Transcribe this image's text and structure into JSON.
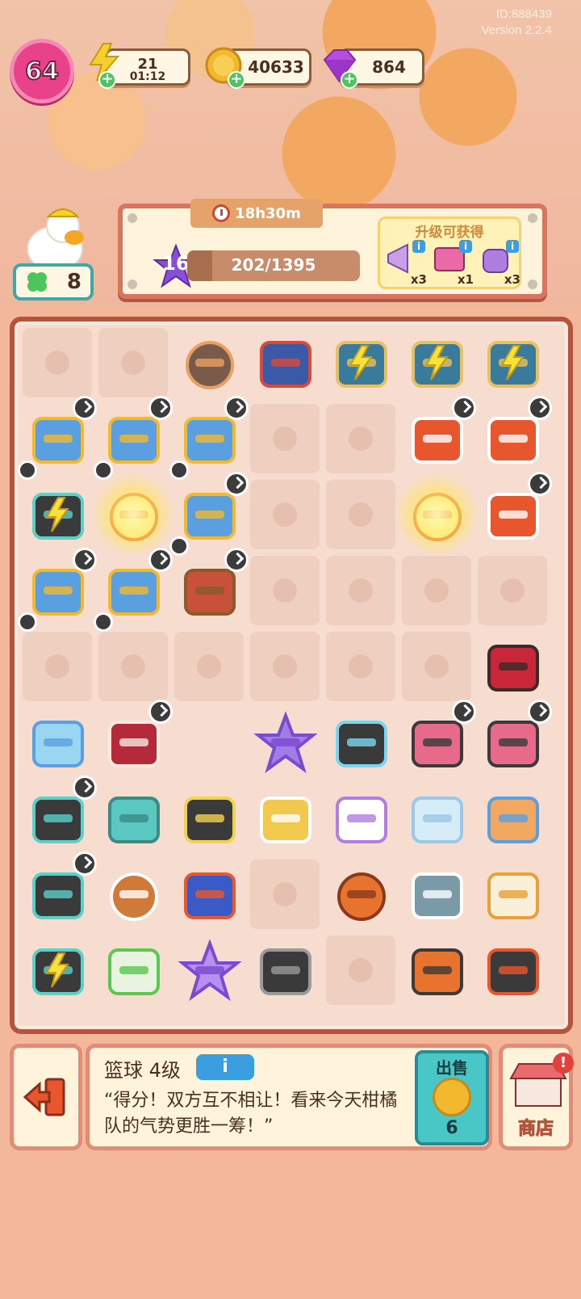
{
  "header": {
    "id_text": "ID:888439",
    "version_text": "Version 2.2.4"
  },
  "player": {
    "level": "64",
    "clover_count": "8"
  },
  "resources": {
    "energy": "21",
    "energy_timer": "01:12",
    "coins": "40633",
    "gems": "864"
  },
  "task": {
    "timer": "18h30m",
    "level": "16",
    "progress_text": "202/1395",
    "progress_fraction": 0.145,
    "reward_title": "升级可获得",
    "rewards": [
      {
        "icon": "megaphone-icon",
        "count": "x3"
      },
      {
        "icon": "go-ticket-icon",
        "count": "x1"
      },
      {
        "icon": "bag-icon",
        "count": "x3"
      }
    ]
  },
  "board": {
    "rows": 9,
    "cols": 7,
    "items": [
      [
        "empty",
        "empty",
        "lantern",
        "temple",
        "building-powered",
        "building-powered",
        "building-powered"
      ],
      [
        "suitcase-timer",
        "suitcase-timer",
        "suitcase-timer",
        "empty",
        "empty",
        "sneakers-timer",
        "sneakers-timer"
      ],
      [
        "backpack-powered",
        "orb-glow",
        "suitcase-timer",
        "empty",
        "empty",
        "orb-glow",
        "sneakers-timer"
      ],
      [
        "suitcase-timer",
        "suitcase-timer",
        "bed-timer",
        "empty",
        "empty",
        "empty",
        "empty"
      ],
      [
        "empty",
        "empty",
        "empty",
        "empty",
        "empty",
        "empty",
        "armchair"
      ],
      [
        "ice-house",
        "book-timer",
        "blank",
        "star",
        "pencil-case",
        "clock-monster-timer",
        "clock-monster-timer"
      ],
      [
        "backpack-timer",
        "drawstring-bag",
        "card",
        "van",
        "tshirt",
        "sugar-jar",
        "easel"
      ],
      [
        "backpack-timer",
        "compass",
        "sneaker-shoe",
        "empty",
        "basketball-selected",
        "fish-mascot",
        "milk-carton"
      ],
      [
        "backpack-powered",
        "bottle",
        "star-big",
        "camera",
        "empty",
        "sports-drink",
        "scoreboard"
      ]
    ]
  },
  "selected": {
    "title": "篮球 4级",
    "info_label": "i",
    "description": "“得分！双方互不相让！看来今天柑橘队的气势更胜一筹！”"
  },
  "actions": {
    "sell_label": "出售",
    "sell_price": "6",
    "shop_label": "商店",
    "shop_alert": "!"
  },
  "colors": {
    "accent_pink": "#e8438a",
    "board_border": "#b5543c",
    "sell_teal": "#49c6c6"
  }
}
